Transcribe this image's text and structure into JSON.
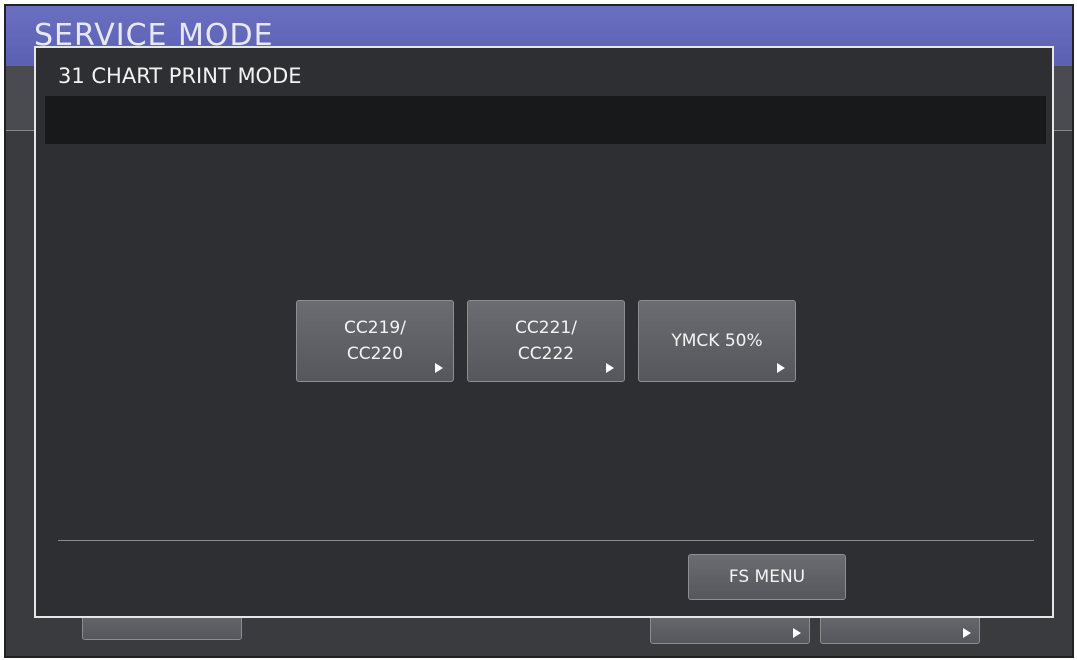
{
  "app": {
    "title": "SERVICE MODE"
  },
  "dialog": {
    "title": "31 CHART PRINT MODE",
    "message": "",
    "buttons": [
      {
        "line1": "CC219/",
        "line2": "CC220",
        "has_arrow": true
      },
      {
        "line1": "CC221/",
        "line2": "CC222",
        "has_arrow": true
      },
      {
        "line1": "YMCK 50%",
        "line2": "",
        "has_arrow": true
      }
    ],
    "fs_menu_label": "FS MENU"
  },
  "colors": {
    "header_blue": "#5b60b3",
    "panel_dark": "#2e2f33",
    "button_gray": "#606267"
  }
}
